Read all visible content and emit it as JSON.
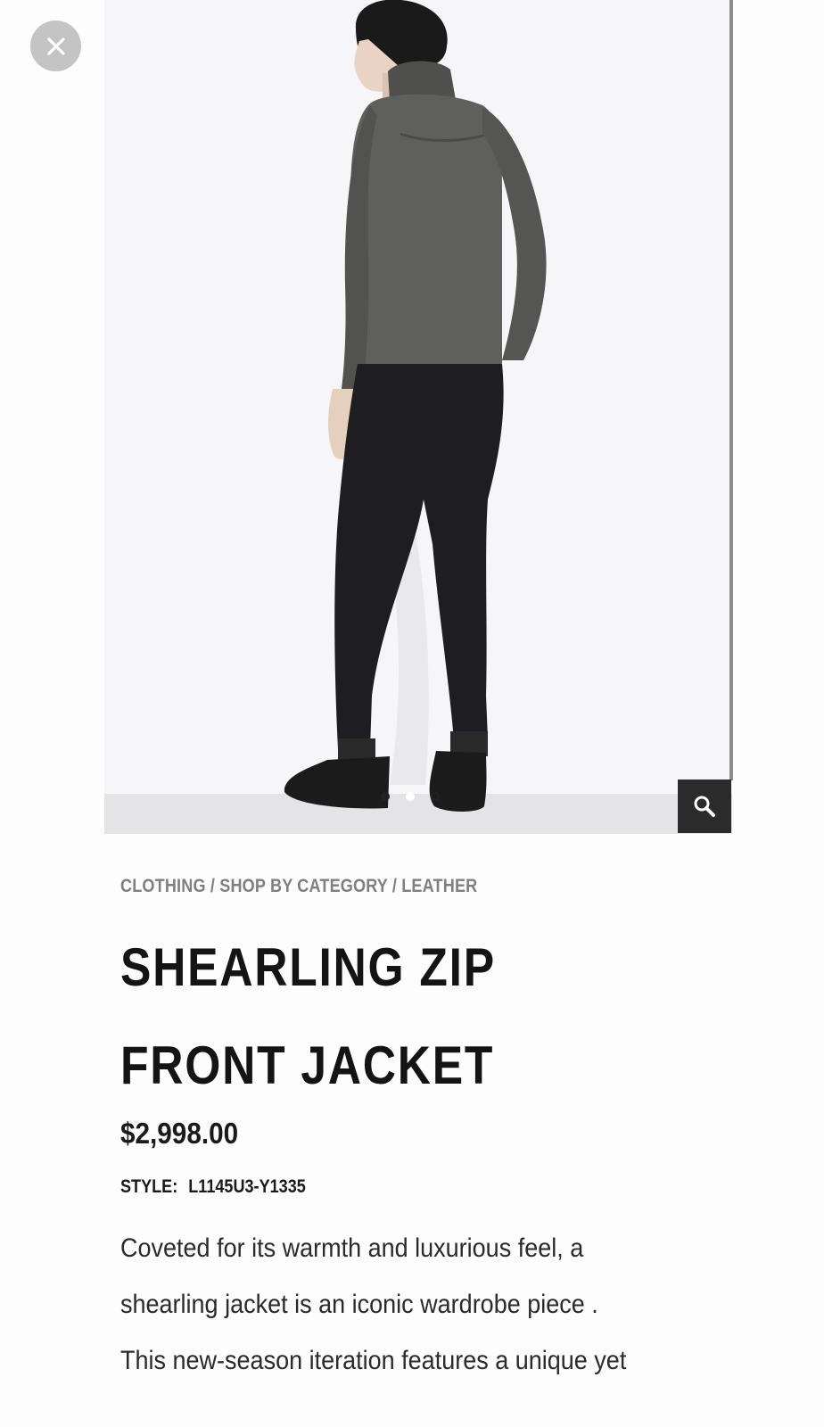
{
  "close": {
    "icon": "close-icon"
  },
  "gallery": {
    "image_alt": "Model wearing shearling zip front jacket, back view",
    "dots": [
      {
        "state": "active"
      },
      {
        "state": "inactive-white"
      },
      {
        "state": "inactive"
      }
    ],
    "zoom": {
      "icon": "search-icon"
    }
  },
  "product": {
    "breadcrumb": "CLOTHING / SHOP BY CATEGORY / LEATHER",
    "title_line1": "SHEARLING ZIP",
    "title_line2": "FRONT JACKET",
    "price": "$2,998.00",
    "style_label": "STYLE:",
    "style_code": "L1145U3-Y1335",
    "description_lines": [
      "Coveted for its warmth and luxurious feel, a",
      "shearling jacket is an iconic wardrobe piece .",
      "This new-season iteration features a unique yet"
    ]
  },
  "colors": {
    "close_bg": "#c4c4c4",
    "zoom_bg": "#2b2b2b",
    "jacket": "#5f5f5d",
    "pants": "#1e1e22",
    "breadcrumb_text": "#7f7f7f",
    "title_text": "#141414"
  }
}
